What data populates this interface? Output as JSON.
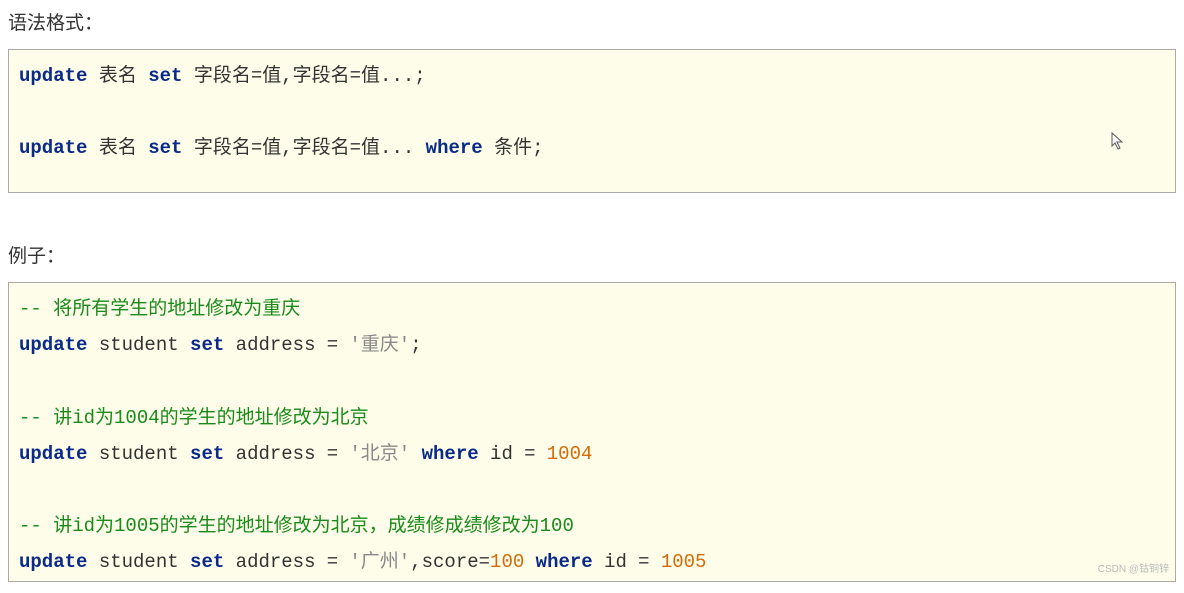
{
  "headings": {
    "syntax": "语法格式：",
    "example": "例子："
  },
  "syntax_block": {
    "l1": {
      "kw1": "update",
      "t1": " 表名 ",
      "kw2": "set",
      "t2": " 字段名=值,字段名=值...;"
    },
    "blank": " ",
    "l2": {
      "kw1": "update",
      "t1": " 表名 ",
      "kw2": "set",
      "t2": " 字段名=值,字段名=值... ",
      "kw3": "where",
      "t3": " 条件;"
    }
  },
  "example_block": {
    "c1": "-- 将所有学生的地址修改为重庆",
    "l1": {
      "kw1": "update",
      "t1": " student ",
      "kw2": "set",
      "t2": " address ",
      "eq": "=",
      "sp": " ",
      "str": "'重庆'",
      "end": ";"
    },
    "bl1": " ",
    "c2": {
      "pre": "-- 讲id为",
      "n": "1004",
      "post": "的学生的地址修改为北京"
    },
    "l2": {
      "kw1": "update",
      "t1": " student ",
      "kw2": "set",
      "t2": " address ",
      "eq": "=",
      "sp": " ",
      "str": "'北京'",
      "sp2": " ",
      "kw3": "where",
      "t3": " id ",
      "eq2": "=",
      "sp3": " ",
      "num": "1004"
    },
    "bl2": " ",
    "c3": {
      "pre": "-- 讲id为",
      "n": "1005",
      "post": "的学生的地址修改为北京，成绩修成绩修改为",
      "n2": "100"
    },
    "l3": {
      "kw1": "update",
      "t1": " student ",
      "kw2": "set",
      "t2": " address ",
      "eq": "=",
      "sp": " ",
      "str": "'广州'",
      "t3": ",score=",
      "num1": "100",
      "sp2": " ",
      "kw3": "where",
      "t4": " id ",
      "eq2": "=",
      "sp3": " ",
      "num2": "1005"
    }
  },
  "watermark": "CSDN @钴铜锌"
}
